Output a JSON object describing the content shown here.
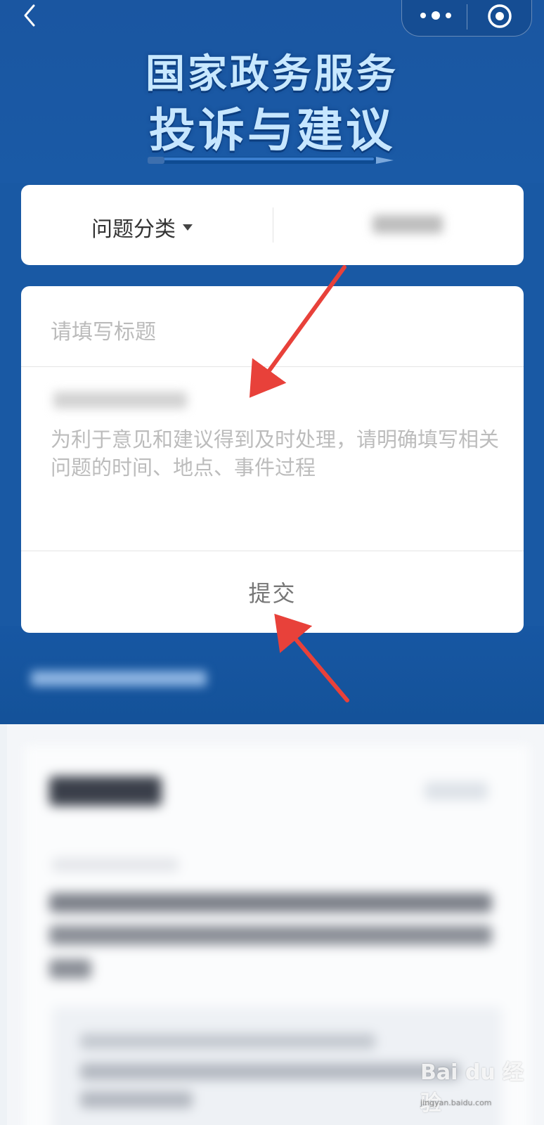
{
  "header": {
    "title_line1": "国家政务服务",
    "title_line2": "投诉与建议"
  },
  "category": {
    "label": "问题分类"
  },
  "form": {
    "title_placeholder": "请填写标题",
    "content_placeholder": "为利于意见和建议得到及时处理，请明确填写相关问题的时间、地点、事件过程",
    "submit_label": "提交"
  },
  "watermark": {
    "text": "Bai du 经验",
    "sub": "jingyan.baidu.com"
  },
  "colors": {
    "hero_blue": "#1959a4",
    "title_color": "#c6e6ff",
    "annotation_arrow": "#e8413a"
  },
  "icons": {
    "back": "chevron-left-icon",
    "more": "more-dots-icon",
    "close": "target-close-icon",
    "dropdown": "caret-down-icon"
  }
}
